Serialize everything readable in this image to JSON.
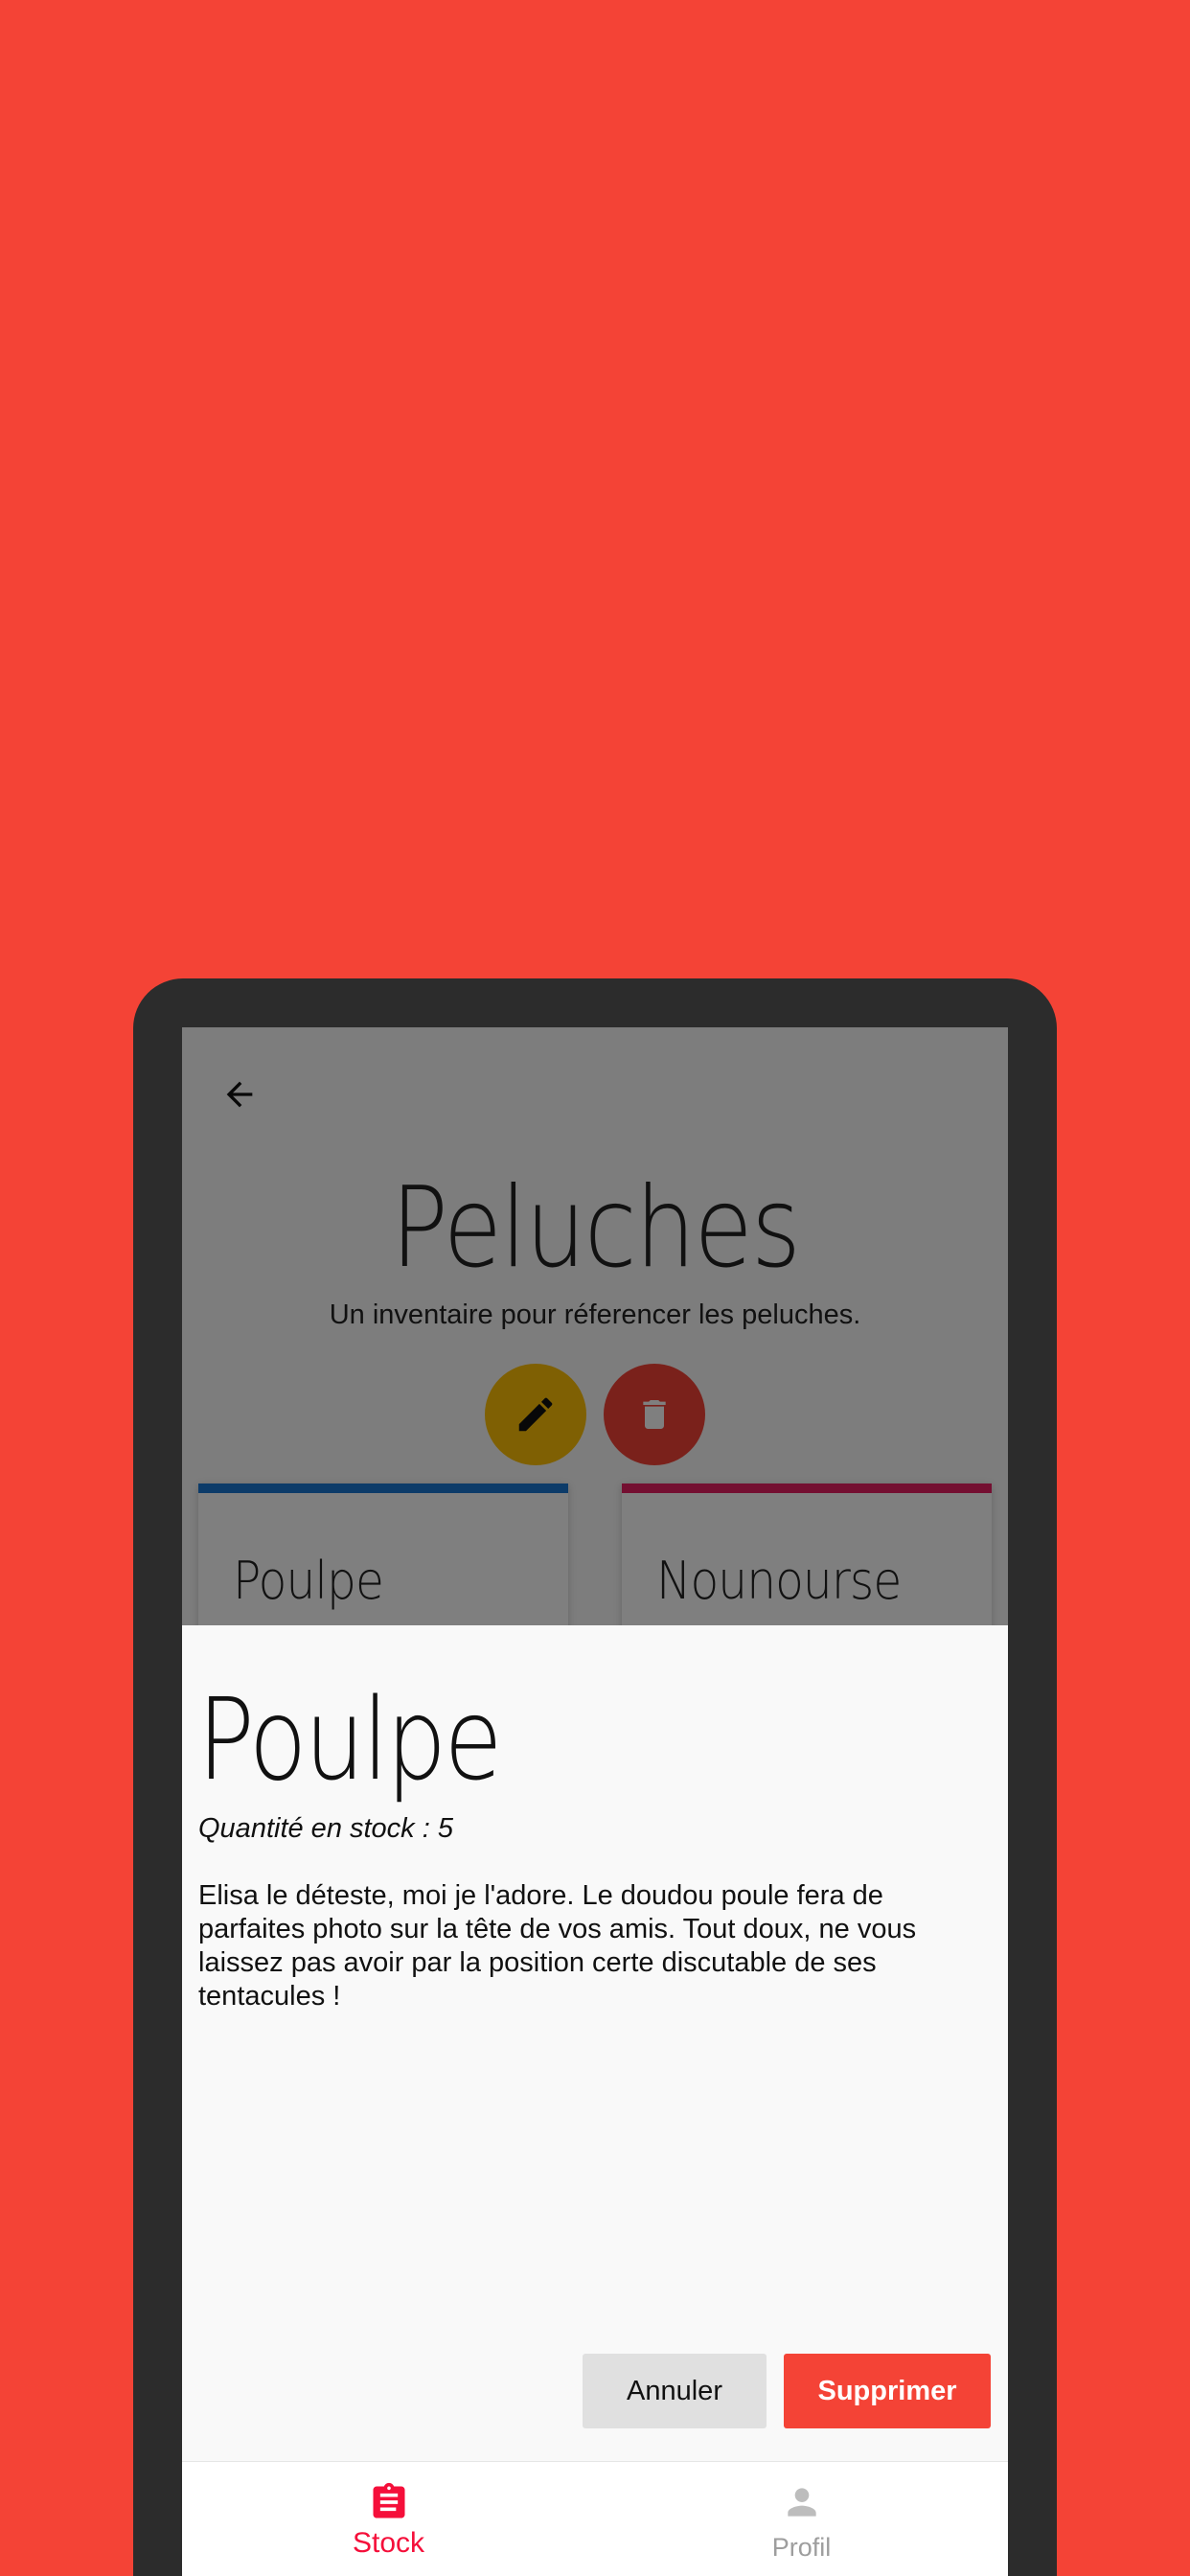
{
  "page": {
    "title": "Peluches",
    "subtitle": "Un inventaire pour réferencer les peluches."
  },
  "cards": [
    {
      "name": "Poulpe",
      "accent": "#1976d2"
    },
    {
      "name": "Nounourse",
      "accent": "#e91e63"
    }
  ],
  "dialog": {
    "title": "Poulpe",
    "quantity": "Quantité en stock : 5",
    "description": "Elisa le déteste, moi je l'adore. Le doudou poule fera de parfaites photo sur la tête de vos amis. Tout doux, ne vous laissez pas avoir par la position certe discutable de ses tentacules !",
    "cancel_label": "Annuler",
    "confirm_label": "Supprimer"
  },
  "bottom_nav": {
    "items": [
      {
        "label": "Stock",
        "icon": "clipboard-icon",
        "active": true
      },
      {
        "label": "Profil",
        "icon": "person-icon",
        "active": false
      }
    ]
  },
  "colors": {
    "background": "#f44336",
    "edit_fab": "#ffc107",
    "delete_fab": "#f44336",
    "active_nav": "#f50f3a"
  }
}
